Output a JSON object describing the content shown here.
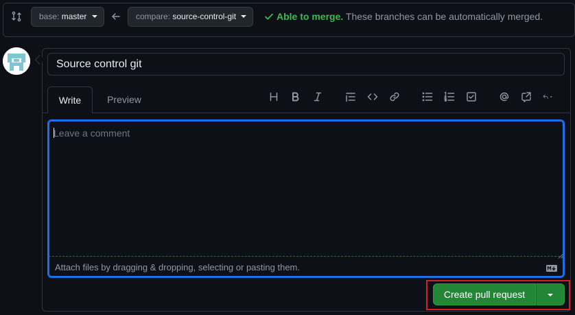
{
  "compare_bar": {
    "compare_icon": "git-compare-icon",
    "base_key": "base:",
    "base_value": "master",
    "arrow_icon": "arrow-left-icon",
    "compare_key": "compare:",
    "compare_value": "source-control-git",
    "merge_ok": "Able to merge.",
    "merge_desc": "These branches can be automatically merged."
  },
  "form": {
    "title_value": "Source control git",
    "tabs": [
      {
        "label": "Write",
        "active": true
      },
      {
        "label": "Preview",
        "active": false
      }
    ],
    "toolbar_icons": [
      "heading-icon",
      "bold-icon",
      "italic-icon",
      "quote-icon",
      "code-icon",
      "link-icon",
      "unordered-list-icon",
      "ordered-list-icon",
      "task-list-icon",
      "mention-icon",
      "cross-reference-icon",
      "reply-icon"
    ],
    "comment_placeholder": "Leave a comment",
    "attach_text": "Attach files by dragging & dropping, selecting or pasting them.",
    "markdown_icon": "markdown-icon",
    "submit_label": "Create pull request"
  },
  "colors": {
    "background": "#0d1117",
    "border": "#30363d",
    "success": "#3fb950",
    "primary_button": "#238636",
    "focus": "#1f6feb",
    "highlight": "#d21f28"
  }
}
